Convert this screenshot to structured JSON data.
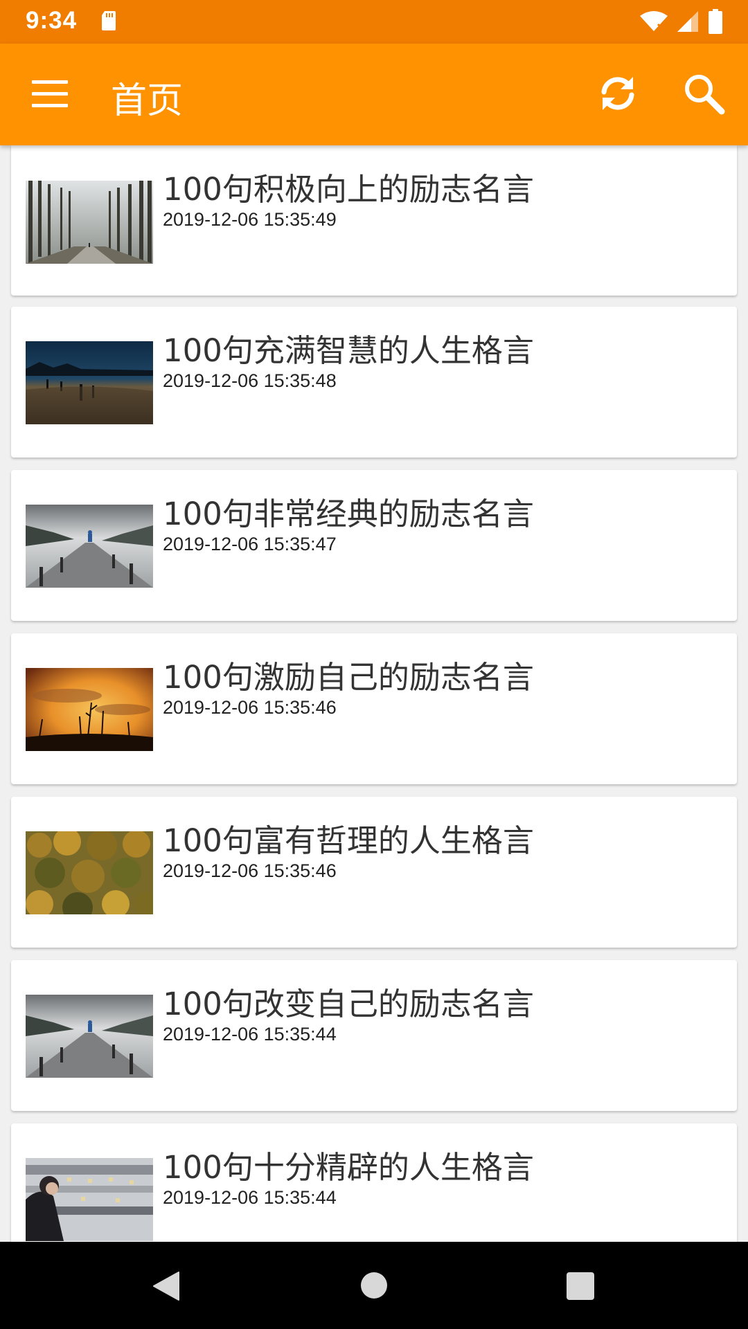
{
  "status_bar": {
    "time": "9:34",
    "icons": [
      "sd-card-icon",
      "wifi-icon",
      "signal-icon",
      "battery-icon"
    ]
  },
  "toolbar": {
    "title": "首页",
    "icons": [
      "menu-icon",
      "refresh-icon",
      "search-icon"
    ],
    "background_color": "#ff9200"
  },
  "articles": [
    {
      "title": "100句积极向上的励志名言",
      "time": "2019-12-06 15:35:49",
      "thumbnail": "foggy-forest-path"
    },
    {
      "title": "100句充满智慧的人生格言",
      "time": "2019-12-06 15:35:48",
      "thumbnail": "night-field-fence"
    },
    {
      "title": "100句非常经典的励志名言",
      "time": "2019-12-06 15:35:47",
      "thumbnail": "lake-pier-person"
    },
    {
      "title": "100句激励自己的励志名言",
      "time": "2019-12-06 15:35:46",
      "thumbnail": "sunset-grass"
    },
    {
      "title": "100句富有哲理的人生格言",
      "time": "2019-12-06 15:35:46",
      "thumbnail": "autumn-forest"
    },
    {
      "title": "100句改变自己的励志名言",
      "time": "2019-12-06 15:35:44",
      "thumbnail": "lake-pier-person"
    },
    {
      "title": "100句十分精辟的人生格言",
      "time": "2019-12-06 15:35:44",
      "thumbnail": "woman-on-phone"
    }
  ],
  "nav_bar": {
    "icons": [
      "back-icon",
      "home-icon",
      "recents-icon"
    ]
  }
}
